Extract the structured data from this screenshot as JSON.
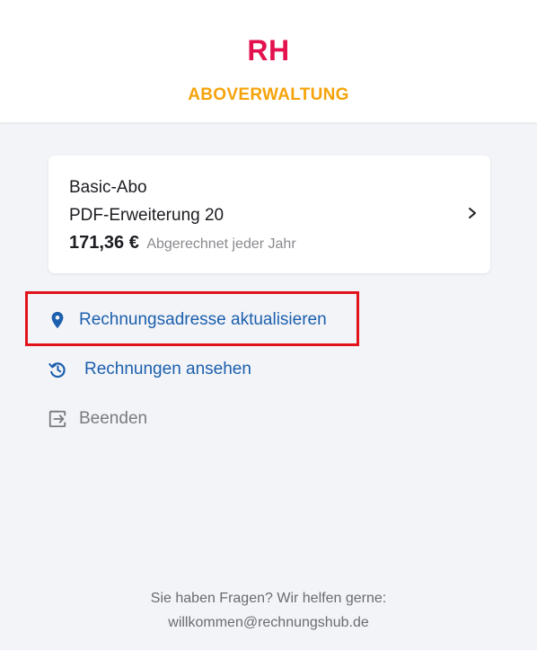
{
  "header": {
    "logo": "RH",
    "subtitle": "ABOVERWALTUNG"
  },
  "subscription": {
    "plan": "Basic-Abo",
    "addon": "PDF-Erweiterung 20",
    "price": "171,36 €",
    "billing": "Abgerechnet jeder Jahr"
  },
  "actions": {
    "update_address": "Rechnungsadresse aktualisieren",
    "view_invoices": "Rechnungen ansehen",
    "cancel": "Beenden"
  },
  "footer": {
    "question": "Sie haben Fragen? Wir helfen gerne:",
    "email": "willkommen@rechnungshub.de"
  },
  "colors": {
    "brand": "#e3124e",
    "accent": "#f5a30a",
    "link": "#1b5fad",
    "highlight": "#e1141b"
  },
  "icons": {
    "address": "map-pin-icon",
    "invoices": "history-icon",
    "cancel": "exit-icon",
    "card": "chevron-right-icon"
  }
}
